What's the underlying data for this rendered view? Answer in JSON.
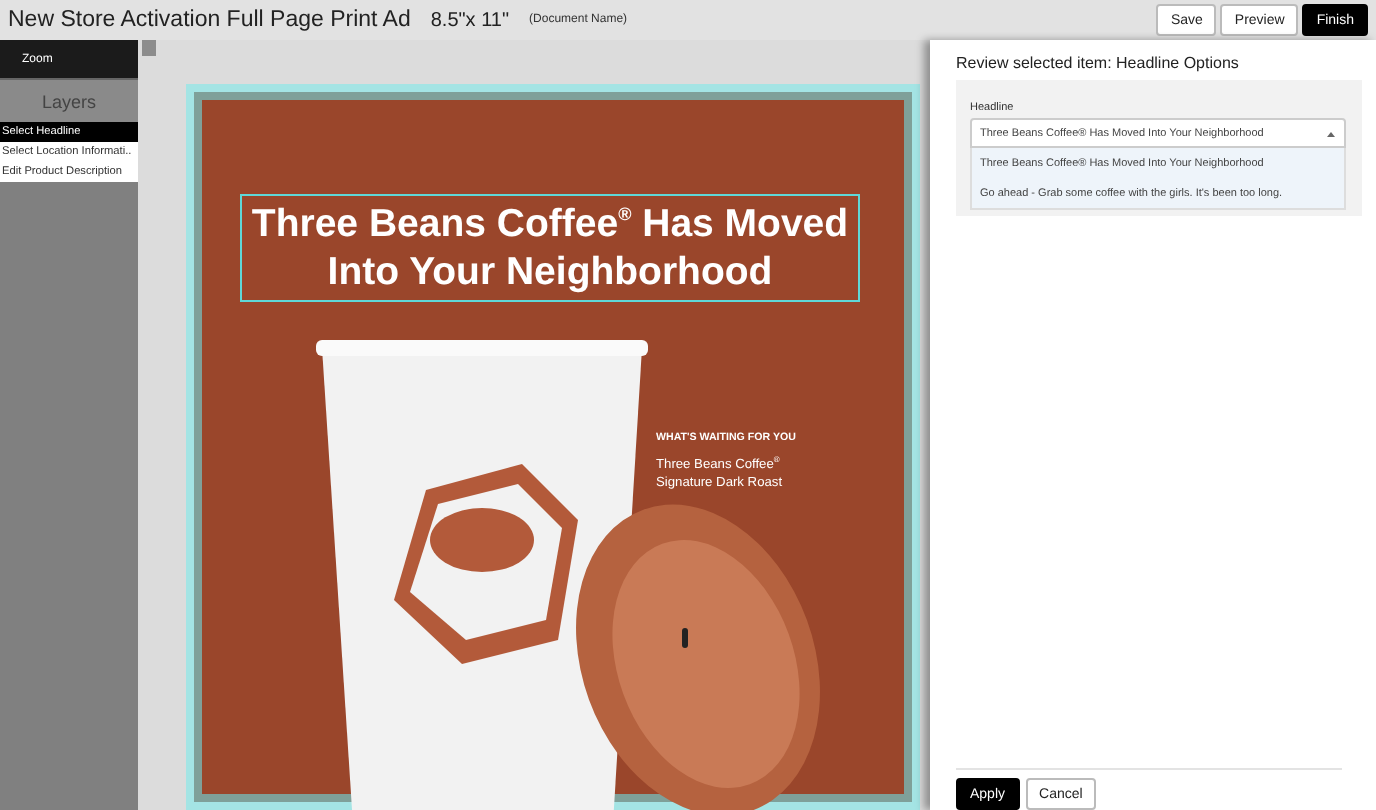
{
  "header": {
    "title": "New Store Activation Full Page Print Ad",
    "size": "8.5\"x 11\"",
    "document_name": "(Document Name)",
    "buttons": [
      {
        "label": "Save",
        "kind": "outline"
      },
      {
        "label": "Preview",
        "kind": "outline"
      },
      {
        "label": "Finish",
        "kind": "primary"
      }
    ]
  },
  "sidebar": {
    "zoom": "Zoom",
    "layers_title": "Layers",
    "layers": [
      {
        "label": "Select Headline",
        "selected": true
      },
      {
        "label": "Select Location Informati..",
        "selected": false
      },
      {
        "label": "Edit Product Description",
        "selected": false
      }
    ]
  },
  "ad": {
    "headline": "Three Beans Coffee$^{®}$ Has Moved Into Your Neighborhood",
    "tagline": "WHAT'S WAITING FOR YOU",
    "product": "Three Beans Coffee$^{®}$ Signature Dark Roast"
  },
  "panel": {
    "title": "Review selected item: Headline Options",
    "field_label": "Headline",
    "value": "Three Beans Coffee® Has Moved Into Your Neighborhood",
    "expanded": true,
    "options": [
      "Three Beans Coffee® Has Moved Into Your Neighborhood",
      "Go ahead - Grab some coffee with the girls. It's been too long."
    ],
    "buttons": [
      {
        "label": "Apply",
        "kind": "primary"
      },
      {
        "label": "Cancel",
        "kind": "outline"
      }
    ]
  }
}
